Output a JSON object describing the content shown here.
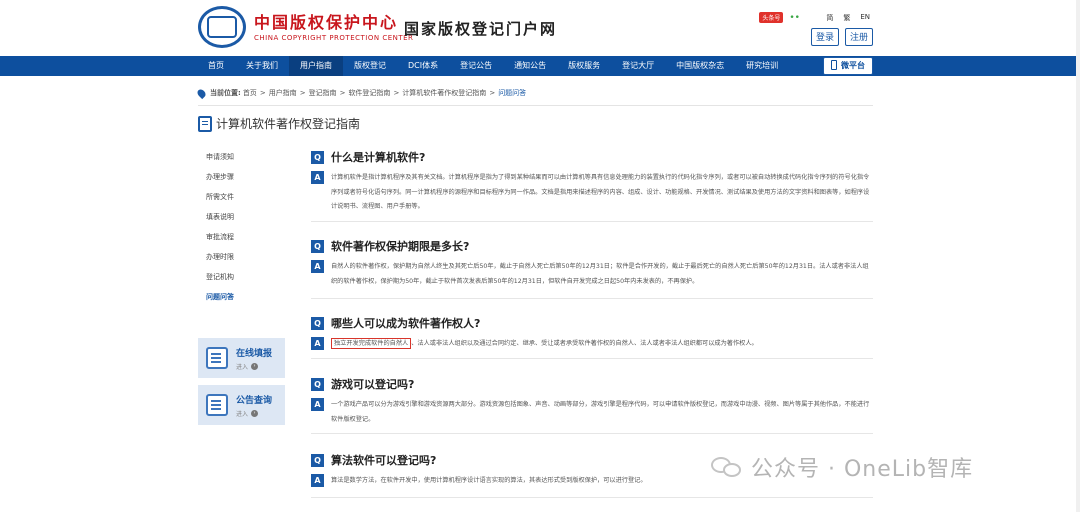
{
  "header": {
    "logo_cn": "中国版权保护中心",
    "logo_en": "CHINA COPYRIGHT PROTECTION CENTER",
    "portal_title": "国家版权登记门户网",
    "weibo": "头条号",
    "wechat": "••",
    "lang": [
      "简",
      "繁",
      "EN"
    ],
    "login": "登录",
    "register": "注册"
  },
  "nav": {
    "items": [
      "首页",
      "关于我们",
      "用户指南",
      "版权登记",
      "DCI体系",
      "登记公告",
      "通知公告",
      "版权服务",
      "登记大厅",
      "中国版权杂志",
      "研究培训"
    ],
    "active_index": 2,
    "wechat_platform": "微平台"
  },
  "breadcrumb": {
    "label": "当前位置:",
    "items": [
      "首页",
      "用户指南",
      "登记指南",
      "软件登记指南",
      "计算机软件著作权登记指南"
    ],
    "current": "问题问答",
    "separator": ">"
  },
  "page_title": "计算机软件著作权登记指南",
  "sidebar": {
    "items": [
      "申请须知",
      "办理步骤",
      "所需文件",
      "填表说明",
      "审批流程",
      "办理时限",
      "登记机构",
      "问题问答"
    ],
    "current_index": 7
  },
  "cards": [
    {
      "title": "在线填报",
      "sub": "进入"
    },
    {
      "title": "公告查询",
      "sub": "进入"
    }
  ],
  "qa": [
    {
      "q": "什么是计算机软件?",
      "a": "计算机软件是指计算机程序及其有关文档。计算机程序是指为了得到某种结果而可以由计算机等具有信息处理能力的装置执行的代码化指令序列，或者可以被自动转换成代码化指令序列的符号化指令序列或者符号化语句序列。同一计算机程序的源程序和目标程序为同一作品。文档是指用来描述程序的内容、组成、设计、功能规格、开发情况、测试结果及使用方法的文字资料和图表等，如程序设计说明书、流程图、用户手册等。"
    },
    {
      "q": "软件著作权保护期限是多长?",
      "a": "自然人的软件著作权，保护期为自然人终生及其死亡后50年，截止于自然人死亡后第50年的12月31日；软件是合作开发的，截止于最后死亡的自然人死亡后第50年的12月31日。法人或者非法人组织的软件著作权，保护期为50年，截止于软件首次发表后第50年的12月31日，但软件自开发完成之日起50年内未发表的，不再保护。"
    },
    {
      "q": "哪些人可以成为软件著作权人?",
      "a_highlight": "独立开发完成软件的自然人",
      "a": "、法人或非法人组织以及通过合同约定、继承、受让或者承受软件著作权的自然人、法人或者非法人组织都可以成为著作权人。"
    },
    {
      "q": "游戏可以登记吗?",
      "a": "一个游戏产品可以分为游戏引擎和游戏资源两大部分。游戏资源包括图象、声音、动画等部分，游戏引擎是程序代码，可以申请软件版权登记，而游戏中动漫、视频、图片等属于其他作品，不能进行软件版权登记。"
    },
    {
      "q": "算法软件可以登记吗?",
      "a": "算法是数学方法，在软件开发中，使用计算机程序设计语言实现的算法，其表达形式受到版权保护，可以进行登记。"
    }
  ],
  "qa_badges": {
    "q": "Q",
    "a": "A"
  },
  "watermark": "公众号 · OneLib智库"
}
